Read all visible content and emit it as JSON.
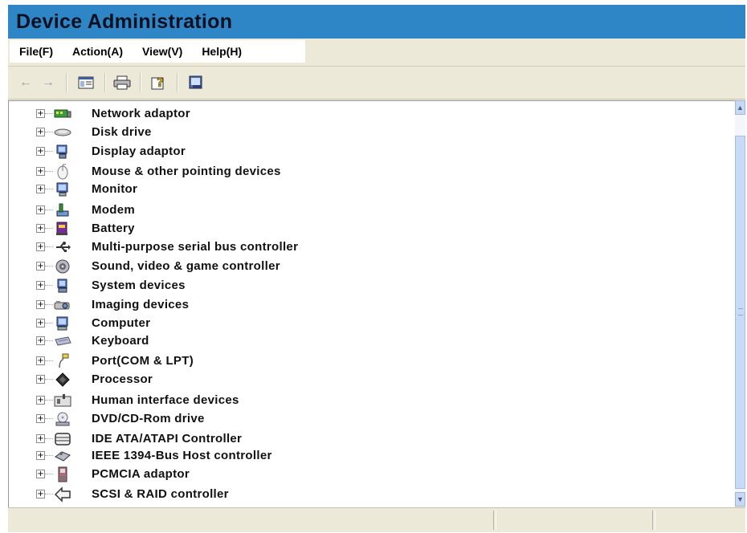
{
  "window": {
    "title": "Device Administration"
  },
  "menu": {
    "items": [
      "File(F)",
      "Action(A)",
      "View(V)",
      "Help(H)"
    ]
  },
  "toolbar": {
    "back_icon": "back-arrow-icon",
    "forward_icon": "forward-arrow-icon",
    "show_hide_icon": "show-hide-console-tree-icon",
    "print_icon": "print-icon",
    "help_icon": "help-icon",
    "properties_icon": "properties-icon"
  },
  "tree": {
    "expander_symbol": "+",
    "items": [
      {
        "label": "Network adaptor",
        "icon": "network-adaptor-icon"
      },
      {
        "label": "Disk drive",
        "icon": "disk-drive-icon"
      },
      {
        "label": "Display adaptor",
        "icon": "display-adaptor-icon"
      },
      {
        "label": "Mouse & other pointing devices",
        "icon": "mouse-icon"
      },
      {
        "label": "Monitor",
        "icon": "monitor-icon"
      },
      {
        "label": "Modem",
        "icon": "modem-icon"
      },
      {
        "label": "Battery",
        "icon": "battery-icon"
      },
      {
        "label": "Multi-purpose serial bus controller",
        "icon": "usb-icon"
      },
      {
        "label": "Sound, video & game controller",
        "icon": "sound-icon"
      },
      {
        "label": "System devices",
        "icon": "system-devices-icon"
      },
      {
        "label": "Imaging devices",
        "icon": "imaging-devices-icon"
      },
      {
        "label": "Computer",
        "icon": "computer-icon"
      },
      {
        "label": "Keyboard",
        "icon": "keyboard-icon"
      },
      {
        "label": "Port(COM & LPT)",
        "icon": "port-icon"
      },
      {
        "label": "Processor",
        "icon": "processor-icon"
      },
      {
        "label": "Human interface devices",
        "icon": "human-interface-devices-icon"
      },
      {
        "label": "DVD/CD-Rom drive",
        "icon": "dvd-cd-rom-icon"
      },
      {
        "label": "IDE ATA/ATAPI Controller",
        "icon": "ide-controller-icon"
      },
      {
        "label": "IEEE 1394-Bus Host controller",
        "icon": "ieee-1394-icon"
      },
      {
        "label": "PCMCIA adaptor",
        "icon": "pcmcia-icon"
      },
      {
        "label": "SCSI & RAID controller",
        "icon": "scsi-raid-icon"
      }
    ]
  },
  "colors": {
    "titlebar": "#2f86c6",
    "window_bg": "#ece9d8",
    "content_bg": "#ffffff"
  }
}
